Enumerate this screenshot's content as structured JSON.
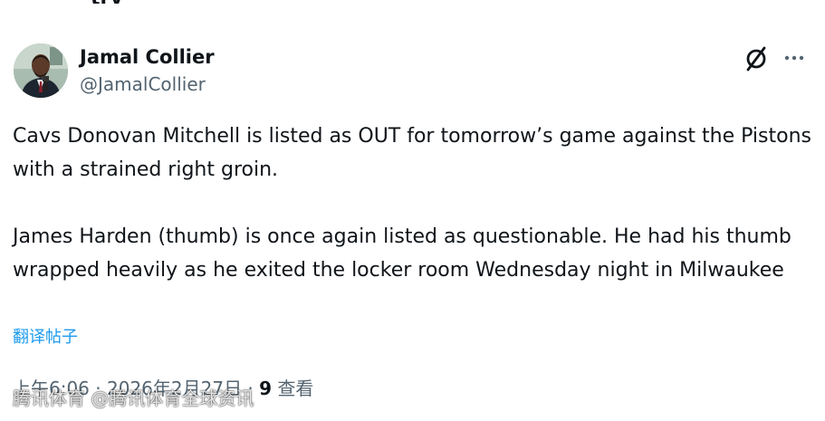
{
  "top_fragment": "try",
  "author": {
    "name": "Jamal Collier",
    "handle": "@JamalCollier"
  },
  "icons": {
    "grok": "grok-icon",
    "more": "more-icon",
    "avatar": "avatar"
  },
  "tweet": {
    "paragraphs": [
      "Cavs Donovan Mitchell is listed as OUT for tomorrow’s game against the Pistons with a strained right groin.",
      "James Harden (thumb) is once again listed as questionable. He had his thumb wrapped heavily as he exited the locker room Wednesday night in Milwaukee"
    ],
    "translate_label": "翻译帖子"
  },
  "meta": {
    "time": "上午6:06",
    "separator1": " · ",
    "date": "2026年2月27日",
    "separator2": " · ",
    "views_count": "9",
    "views_label": " 查看"
  },
  "watermark": "腾讯体育 @腾讯体育全球资讯",
  "colors": {
    "text": "#0f1419",
    "secondary": "#536471",
    "link": "#1d9bf0",
    "background": "#ffffff"
  }
}
